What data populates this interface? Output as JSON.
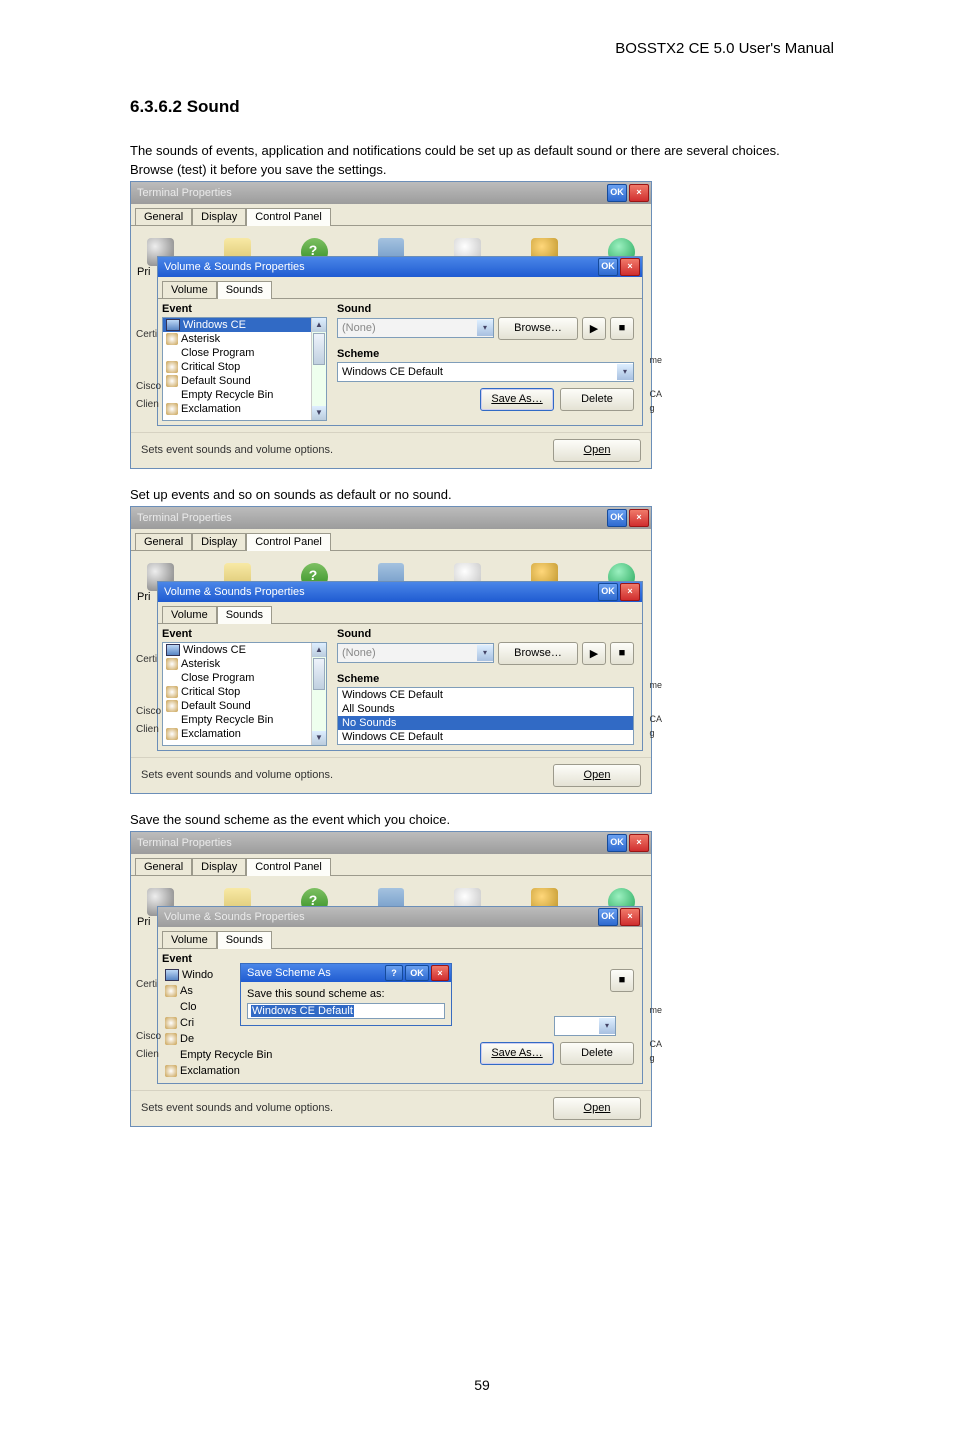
{
  "header": {
    "title": "BOSSTX2 CE 5.0 User's Manual"
  },
  "section": {
    "title": "6.3.6.2 Sound",
    "intro_line1": "The sounds of events, application and notifications could be set up as default sound or there are several choices.",
    "intro_line2": "Browse (test) it before you save the settings."
  },
  "common": {
    "ok": "OK",
    "event": "Event",
    "sound": "Sound",
    "scheme": "Scheme",
    "browse": "Browse…",
    "save_as": "Save As…",
    "delete": "Delete",
    "open": "Open",
    "status": "Sets event sounds and volume options."
  },
  "screenshot1": {
    "outer": {
      "title": "Terminal Properties",
      "tabs": [
        "General",
        "Display",
        "Control Panel"
      ]
    },
    "inner": {
      "title": "Volume & Sounds Properties",
      "tabs": [
        "Volume",
        "Sounds"
      ],
      "events": [
        "Windows CE",
        "Asterisk",
        "Close Program",
        "Critical Stop",
        "Default Sound",
        "Empty Recycle Bin",
        "Exclamation"
      ],
      "sound_value": "(None)",
      "scheme_value": "Windows CE Default"
    }
  },
  "screenshot2": {
    "caption": "Set up events and so on sounds as default or no sound.",
    "events": [
      "Windows CE",
      "Asterisk",
      "Close Program",
      "Critical Stop",
      "Default Sound",
      "Empty Recycle Bin",
      "Exclamation"
    ],
    "scheme_options": [
      "Windows CE Default",
      "All Sounds",
      "No Sounds",
      "Windows CE Default"
    ]
  },
  "screenshot3": {
    "caption": "Save the sound scheme as the event which you choice.",
    "events_vis": [
      "Windo",
      "As",
      "Clo",
      "Cri",
      "De",
      "Empty Recycle Bin",
      "Exclamation"
    ],
    "modal": {
      "title": "Save Scheme As",
      "prompt": "Save this sound scheme as:",
      "value": "Windows CE Default"
    }
  },
  "page_number": "59"
}
